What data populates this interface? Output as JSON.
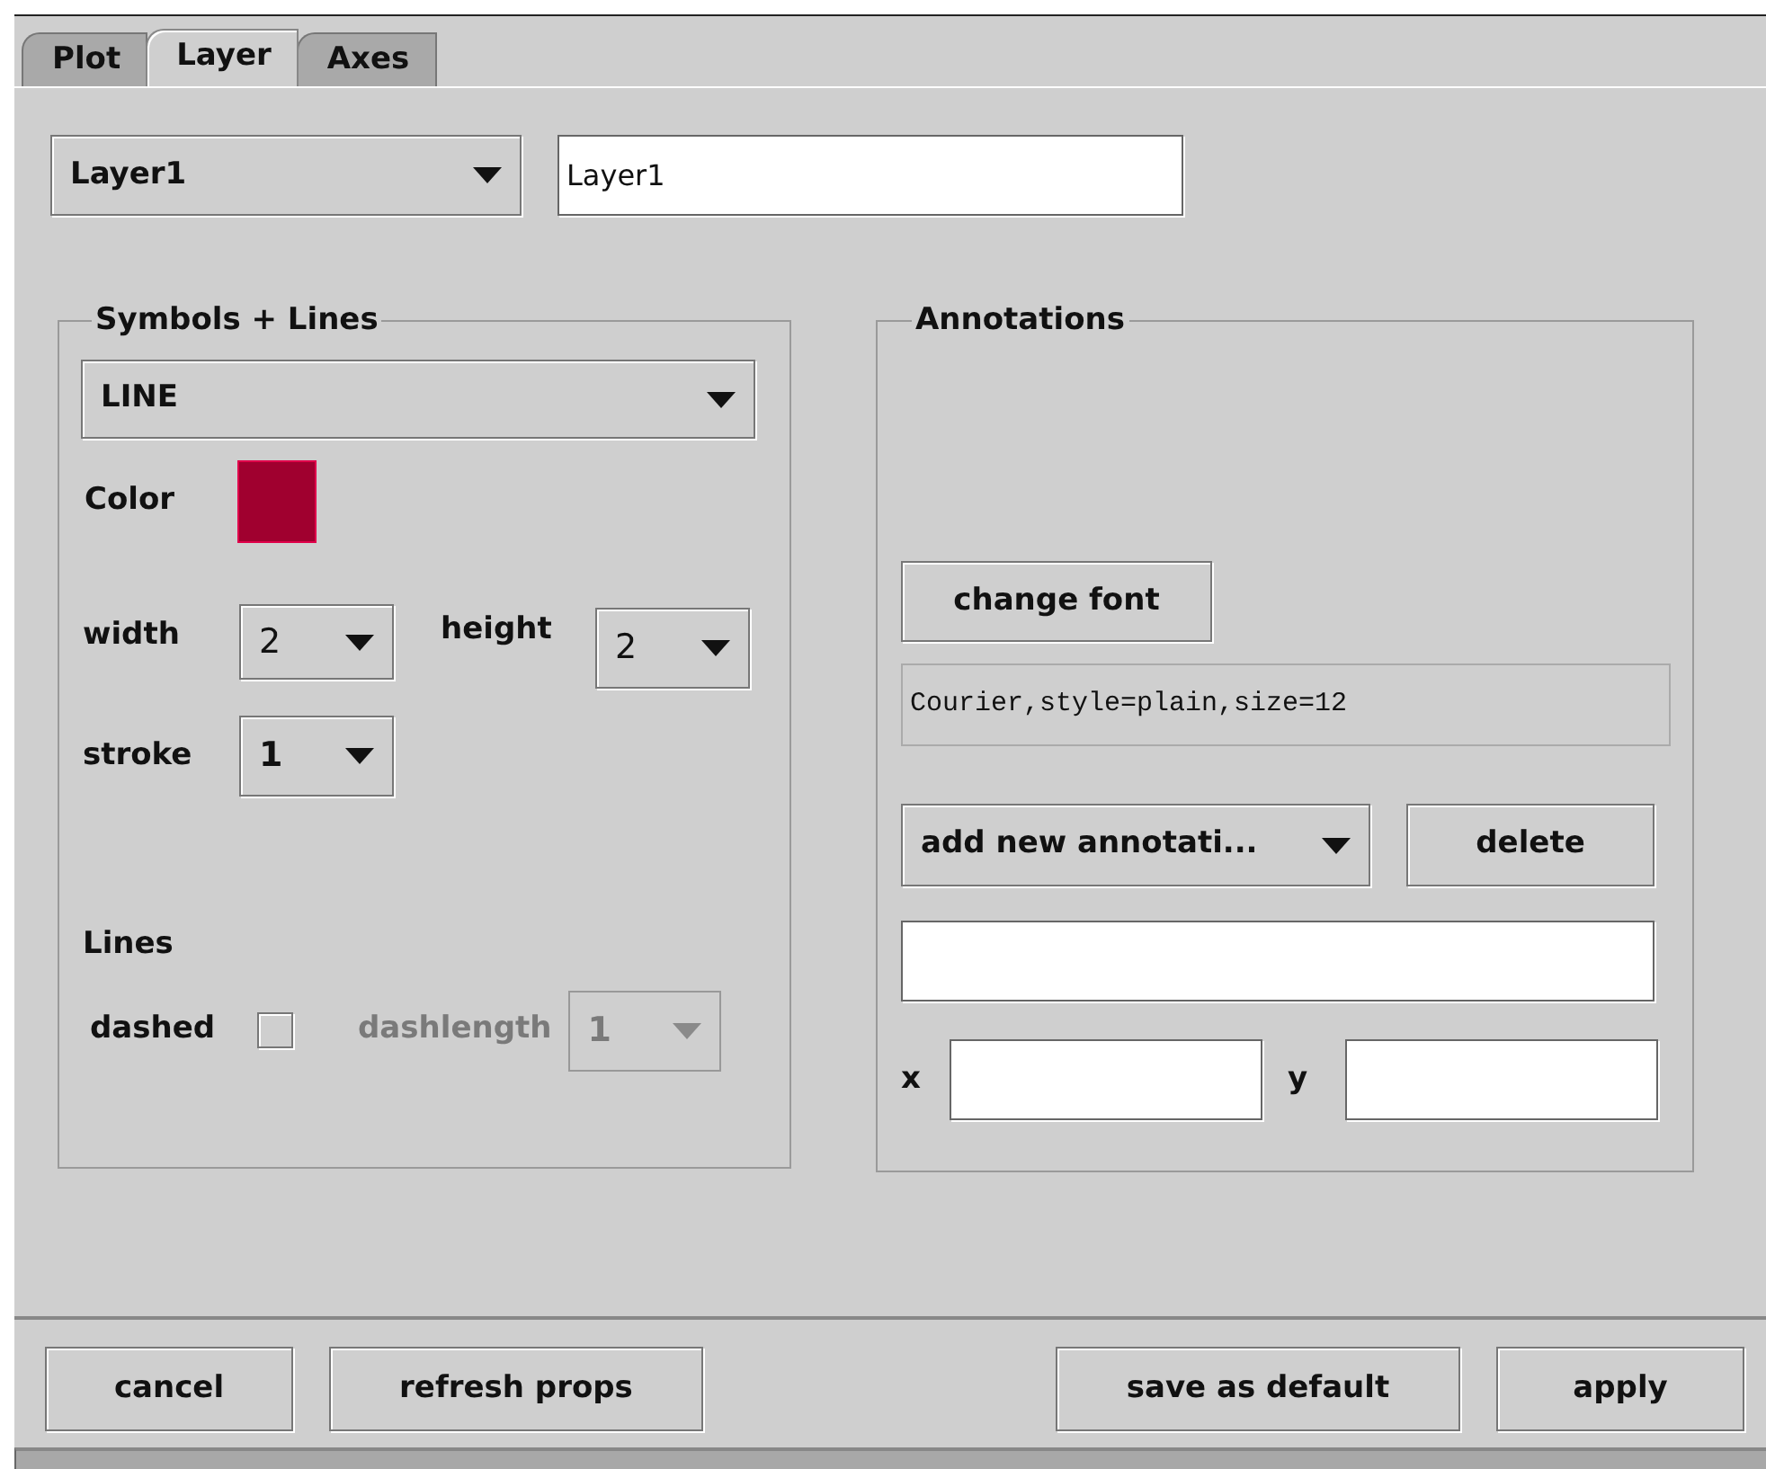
{
  "tabs": [
    {
      "label": "Plot",
      "selected": false
    },
    {
      "label": "Layer",
      "selected": true
    },
    {
      "label": "Axes",
      "selected": false
    }
  ],
  "layer_select": {
    "value": "Layer1"
  },
  "layer_name": {
    "value": "Layer1"
  },
  "symbols_lines": {
    "title": "Symbols + Lines",
    "type_select": {
      "value": "LINE"
    },
    "color": {
      "label": "Color",
      "color": "#a0002f"
    },
    "width": {
      "label": "width",
      "value": "2"
    },
    "height": {
      "label": "height",
      "value": "2"
    },
    "stroke": {
      "label": "stroke",
      "value": "1"
    },
    "lines_heading": "Lines",
    "dashed": {
      "label": "dashed",
      "checked": false
    },
    "dashlength": {
      "label": "dashlength",
      "value": "1",
      "disabled": true
    }
  },
  "annotations": {
    "title": "Annotations",
    "change_font": "change font",
    "font_display": "Courier,style=plain,size=12",
    "add_select": {
      "value": "add new annotati..."
    },
    "delete": "delete",
    "x": {
      "label": "x"
    },
    "y": {
      "label": "y"
    }
  },
  "left_buttons": [
    "cancel",
    "refresh props"
  ],
  "right_buttons": [
    "save as default",
    "apply"
  ]
}
